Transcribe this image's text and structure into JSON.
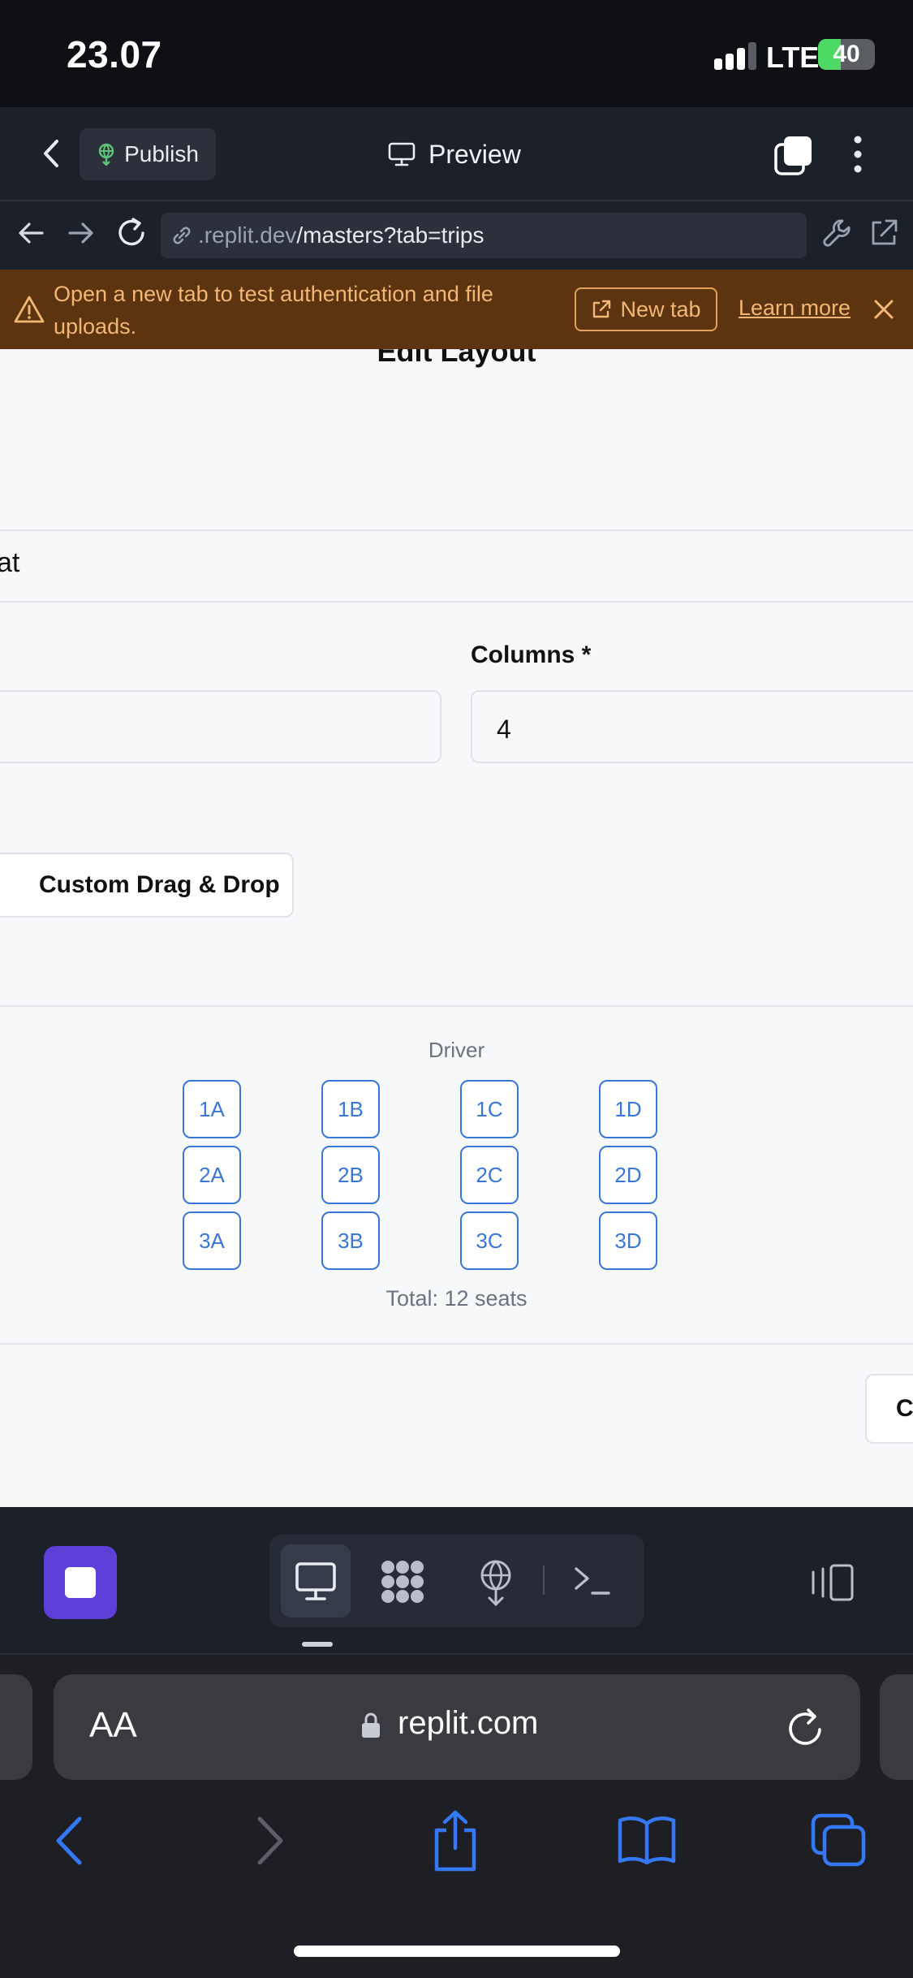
{
  "status_bar": {
    "time": "23.07",
    "network": "LTE",
    "battery": "40",
    "battery_level": 0.4
  },
  "header": {
    "publish_label": "Publish",
    "preview_label": "Preview"
  },
  "address": {
    "url_prefix": ".replit.dev",
    "url_path": "/masters?tab=trips"
  },
  "banner": {
    "message": "Open a new tab to test authentication and file uploads.",
    "new_tab_label": "New tab",
    "learn_more_label": "Learn more"
  },
  "form": {
    "title": "Edit Layout",
    "seat_partial": "at",
    "columns_label": "Columns *",
    "columns_value": "4",
    "custom_button": "Custom Drag & Drop",
    "driver_label": "Driver",
    "seats": [
      [
        "1A",
        "1B",
        "1C",
        "1D"
      ],
      [
        "2A",
        "2B",
        "2C",
        "2D"
      ],
      [
        "3A",
        "3B",
        "3C",
        "3D"
      ]
    ],
    "total_label": "Total: 12 seats",
    "c_button": "C"
  },
  "safari": {
    "aa_label": "AA",
    "domain": "replit.com"
  },
  "colors": {
    "accent_purple": "#5b3fd6",
    "banner_bg": "#5c3410",
    "banner_text": "#f2b675",
    "seat_blue": "#3a77d4",
    "safari_blue": "#3478f6"
  }
}
